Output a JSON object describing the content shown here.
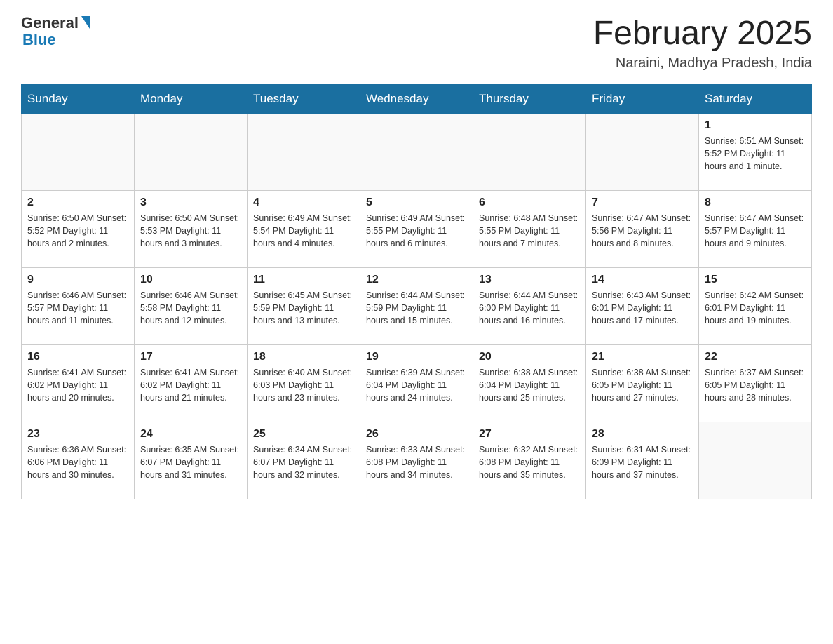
{
  "header": {
    "logo_general": "General",
    "logo_blue": "Blue",
    "month_title": "February 2025",
    "location": "Naraini, Madhya Pradesh, India"
  },
  "weekdays": [
    "Sunday",
    "Monday",
    "Tuesday",
    "Wednesday",
    "Thursday",
    "Friday",
    "Saturday"
  ],
  "weeks": [
    [
      {
        "day": "",
        "info": ""
      },
      {
        "day": "",
        "info": ""
      },
      {
        "day": "",
        "info": ""
      },
      {
        "day": "",
        "info": ""
      },
      {
        "day": "",
        "info": ""
      },
      {
        "day": "",
        "info": ""
      },
      {
        "day": "1",
        "info": "Sunrise: 6:51 AM\nSunset: 5:52 PM\nDaylight: 11 hours and 1 minute."
      }
    ],
    [
      {
        "day": "2",
        "info": "Sunrise: 6:50 AM\nSunset: 5:52 PM\nDaylight: 11 hours and 2 minutes."
      },
      {
        "day": "3",
        "info": "Sunrise: 6:50 AM\nSunset: 5:53 PM\nDaylight: 11 hours and 3 minutes."
      },
      {
        "day": "4",
        "info": "Sunrise: 6:49 AM\nSunset: 5:54 PM\nDaylight: 11 hours and 4 minutes."
      },
      {
        "day": "5",
        "info": "Sunrise: 6:49 AM\nSunset: 5:55 PM\nDaylight: 11 hours and 6 minutes."
      },
      {
        "day": "6",
        "info": "Sunrise: 6:48 AM\nSunset: 5:55 PM\nDaylight: 11 hours and 7 minutes."
      },
      {
        "day": "7",
        "info": "Sunrise: 6:47 AM\nSunset: 5:56 PM\nDaylight: 11 hours and 8 minutes."
      },
      {
        "day": "8",
        "info": "Sunrise: 6:47 AM\nSunset: 5:57 PM\nDaylight: 11 hours and 9 minutes."
      }
    ],
    [
      {
        "day": "9",
        "info": "Sunrise: 6:46 AM\nSunset: 5:57 PM\nDaylight: 11 hours and 11 minutes."
      },
      {
        "day": "10",
        "info": "Sunrise: 6:46 AM\nSunset: 5:58 PM\nDaylight: 11 hours and 12 minutes."
      },
      {
        "day": "11",
        "info": "Sunrise: 6:45 AM\nSunset: 5:59 PM\nDaylight: 11 hours and 13 minutes."
      },
      {
        "day": "12",
        "info": "Sunrise: 6:44 AM\nSunset: 5:59 PM\nDaylight: 11 hours and 15 minutes."
      },
      {
        "day": "13",
        "info": "Sunrise: 6:44 AM\nSunset: 6:00 PM\nDaylight: 11 hours and 16 minutes."
      },
      {
        "day": "14",
        "info": "Sunrise: 6:43 AM\nSunset: 6:01 PM\nDaylight: 11 hours and 17 minutes."
      },
      {
        "day": "15",
        "info": "Sunrise: 6:42 AM\nSunset: 6:01 PM\nDaylight: 11 hours and 19 minutes."
      }
    ],
    [
      {
        "day": "16",
        "info": "Sunrise: 6:41 AM\nSunset: 6:02 PM\nDaylight: 11 hours and 20 minutes."
      },
      {
        "day": "17",
        "info": "Sunrise: 6:41 AM\nSunset: 6:02 PM\nDaylight: 11 hours and 21 minutes."
      },
      {
        "day": "18",
        "info": "Sunrise: 6:40 AM\nSunset: 6:03 PM\nDaylight: 11 hours and 23 minutes."
      },
      {
        "day": "19",
        "info": "Sunrise: 6:39 AM\nSunset: 6:04 PM\nDaylight: 11 hours and 24 minutes."
      },
      {
        "day": "20",
        "info": "Sunrise: 6:38 AM\nSunset: 6:04 PM\nDaylight: 11 hours and 25 minutes."
      },
      {
        "day": "21",
        "info": "Sunrise: 6:38 AM\nSunset: 6:05 PM\nDaylight: 11 hours and 27 minutes."
      },
      {
        "day": "22",
        "info": "Sunrise: 6:37 AM\nSunset: 6:05 PM\nDaylight: 11 hours and 28 minutes."
      }
    ],
    [
      {
        "day": "23",
        "info": "Sunrise: 6:36 AM\nSunset: 6:06 PM\nDaylight: 11 hours and 30 minutes."
      },
      {
        "day": "24",
        "info": "Sunrise: 6:35 AM\nSunset: 6:07 PM\nDaylight: 11 hours and 31 minutes."
      },
      {
        "day": "25",
        "info": "Sunrise: 6:34 AM\nSunset: 6:07 PM\nDaylight: 11 hours and 32 minutes."
      },
      {
        "day": "26",
        "info": "Sunrise: 6:33 AM\nSunset: 6:08 PM\nDaylight: 11 hours and 34 minutes."
      },
      {
        "day": "27",
        "info": "Sunrise: 6:32 AM\nSunset: 6:08 PM\nDaylight: 11 hours and 35 minutes."
      },
      {
        "day": "28",
        "info": "Sunrise: 6:31 AM\nSunset: 6:09 PM\nDaylight: 11 hours and 37 minutes."
      },
      {
        "day": "",
        "info": ""
      }
    ]
  ]
}
